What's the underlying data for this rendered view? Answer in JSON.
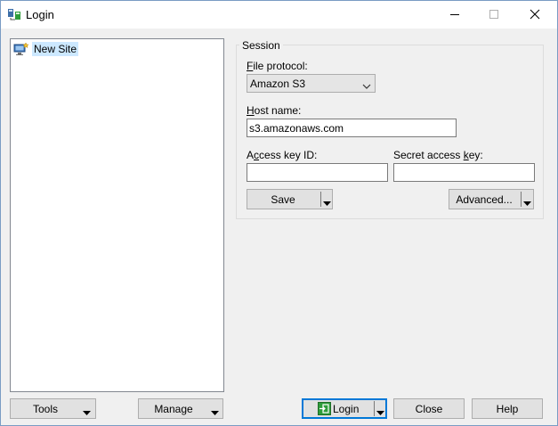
{
  "window": {
    "title": "Login",
    "icon": "winscp-app-icon"
  },
  "site_tree": {
    "items": [
      {
        "label": "New Site",
        "icon": "new-site-icon",
        "selected": true
      }
    ]
  },
  "session": {
    "group_title": "Session",
    "file_protocol": {
      "label_access": "F",
      "label_rest": "ile protocol:",
      "value": "Amazon S3"
    },
    "host_name": {
      "label_access": "H",
      "label_rest": "ost name:",
      "value": "s3.amazonaws.com"
    },
    "access_key": {
      "label_pre": "A",
      "label_access": "c",
      "label_rest": "cess key ID:",
      "value": ""
    },
    "secret_key": {
      "label_pre": "Secret access ",
      "label_access": "k",
      "label_rest": "ey:",
      "value": ""
    },
    "save_label": "Save",
    "advanced_label": "Advanced..."
  },
  "footer": {
    "tools_label": "Tools",
    "manage_label": "Manage",
    "login_label": "Login",
    "close_label": "Close",
    "help_label": "Help"
  },
  "colors": {
    "accent": "#0078d7",
    "selection": "#cce8ff",
    "login_icon_green": "#2e9d3a"
  }
}
